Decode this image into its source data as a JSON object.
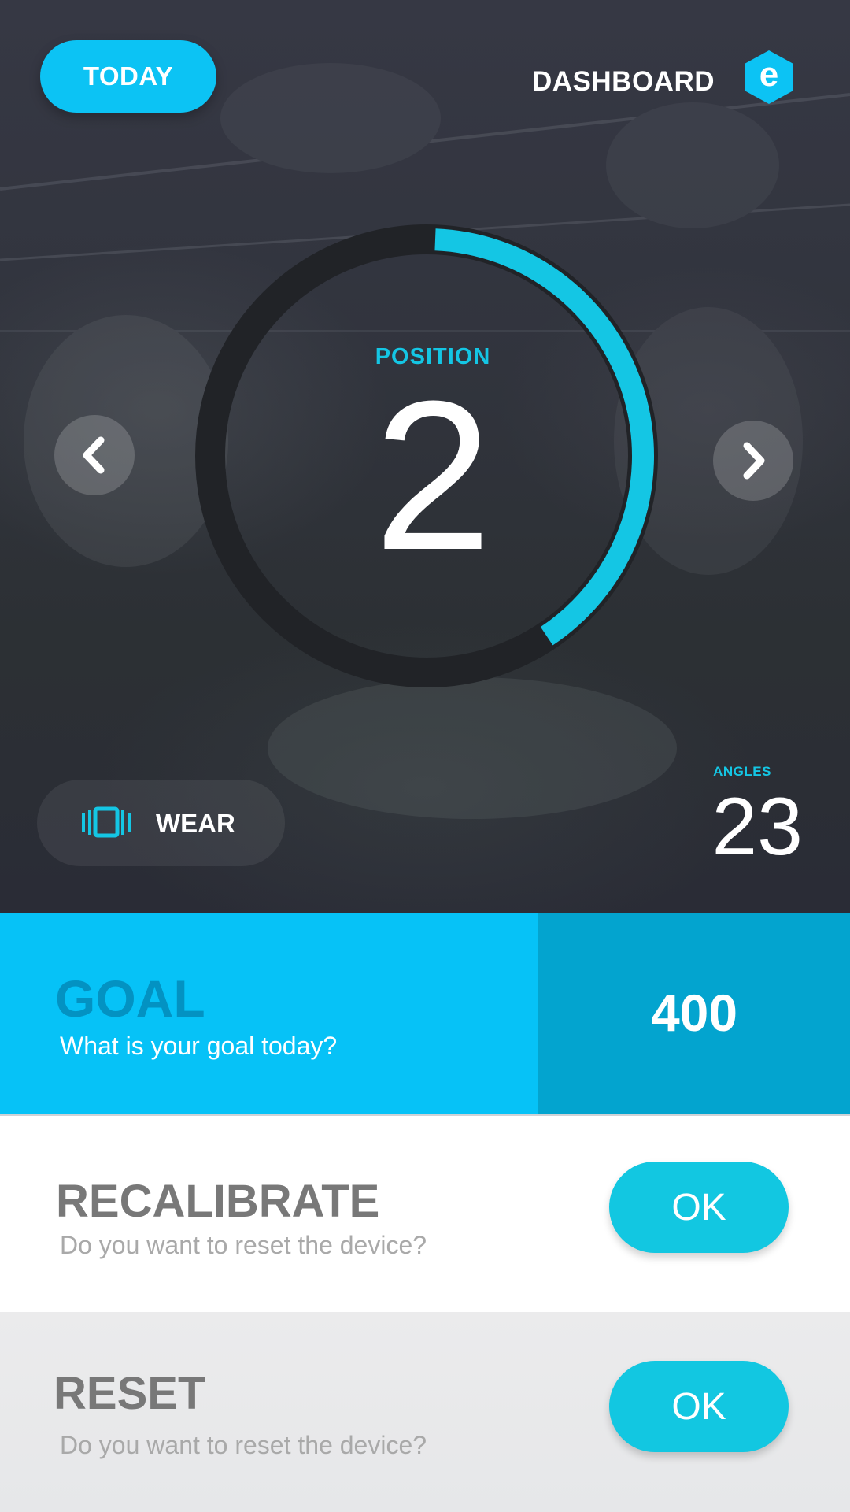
{
  "header": {
    "today_label": "TODAY",
    "title": "DASHBOARD",
    "logo_letter": "e"
  },
  "position": {
    "label": "POSITION",
    "value": "2",
    "progress_fraction": 0.4
  },
  "wear": {
    "label": "WEAR",
    "icon": "vibrate-icon"
  },
  "angles": {
    "label": "ANGLES",
    "value": "23"
  },
  "goal": {
    "title": "GOAL",
    "subtitle": "What is your goal today?",
    "value": "400"
  },
  "recalibrate": {
    "title": "RECALIBRATE",
    "subtitle": "Do you want to reset the device?",
    "button_label": "OK"
  },
  "reset": {
    "title": "RESET",
    "subtitle": "Do you want to reset the device?",
    "button_label": "OK"
  },
  "colors": {
    "accent": "#0cc3f4",
    "ring_progress": "#14c6e4",
    "goal_dark": "#03a4cf",
    "ok_button": "#12c7e1"
  }
}
